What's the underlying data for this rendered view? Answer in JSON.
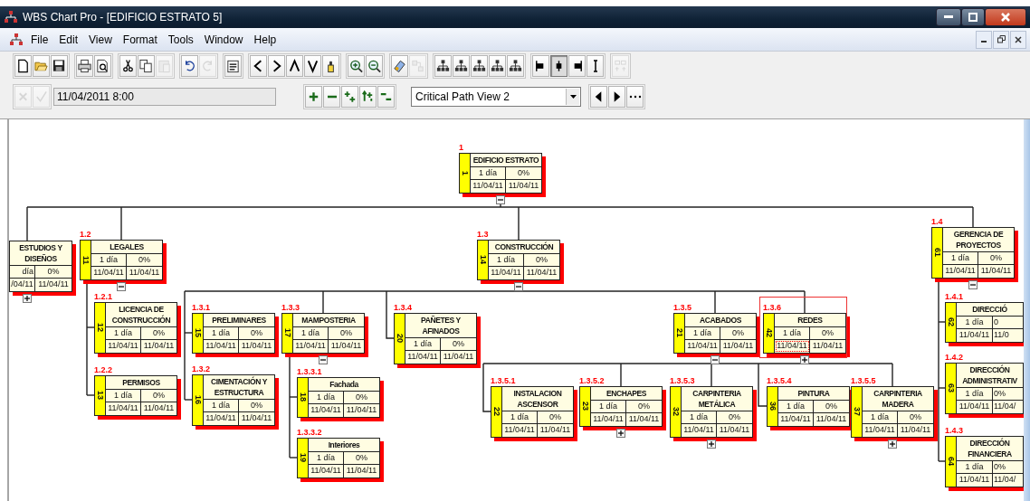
{
  "window": {
    "title": "WBS Chart Pro - [EDIFICIO ESTRATO 5]"
  },
  "menu": [
    "File",
    "Edit",
    "View",
    "Format",
    "Tools",
    "Window",
    "Help"
  ],
  "toolbar": [
    [
      {
        "kind": "new",
        "disabled": false,
        "pressed": false
      },
      {
        "kind": "open",
        "disabled": false,
        "pressed": false
      },
      {
        "kind": "save",
        "disabled": false,
        "pressed": false
      }
    ],
    [
      {
        "kind": "print",
        "disabled": false,
        "pressed": false
      },
      {
        "kind": "preview",
        "disabled": false,
        "pressed": false
      }
    ],
    [
      {
        "kind": "cut",
        "disabled": false,
        "pressed": false
      },
      {
        "kind": "copy",
        "disabled": false,
        "pressed": false
      },
      {
        "kind": "paste",
        "disabled": true,
        "pressed": false
      }
    ],
    [
      {
        "kind": "undo",
        "disabled": false,
        "pressed": false
      },
      {
        "kind": "redo",
        "disabled": true,
        "pressed": false
      }
    ],
    [
      {
        "kind": "notes",
        "disabled": false,
        "pressed": false
      }
    ],
    [
      {
        "kind": "left",
        "disabled": false,
        "pressed": false
      },
      {
        "kind": "right",
        "disabled": false,
        "pressed": false
      },
      {
        "kind": "up",
        "disabled": false,
        "pressed": false
      },
      {
        "kind": "down",
        "disabled": false,
        "pressed": false
      },
      {
        "kind": "marker",
        "disabled": false,
        "pressed": false
      }
    ],
    [
      {
        "kind": "zoom-in",
        "disabled": false,
        "pressed": false
      },
      {
        "kind": "zoom-out",
        "disabled": false,
        "pressed": false
      }
    ],
    [
      {
        "kind": "paint",
        "disabled": false,
        "pressed": false
      },
      {
        "kind": "link",
        "disabled": true,
        "pressed": false
      }
    ],
    [
      {
        "kind": "tree",
        "disabled": false,
        "pressed": false
      },
      {
        "kind": "tree-wide",
        "disabled": false,
        "pressed": false
      },
      {
        "kind": "tree-list",
        "disabled": false,
        "pressed": false
      },
      {
        "kind": "tree-both",
        "disabled": false,
        "pressed": false
      },
      {
        "kind": "tree-grid",
        "disabled": false,
        "pressed": false
      }
    ],
    [
      {
        "kind": "align-left",
        "disabled": false,
        "pressed": false
      },
      {
        "kind": "align-center",
        "disabled": false,
        "pressed": true
      },
      {
        "kind": "align-right",
        "disabled": false,
        "pressed": false
      },
      {
        "kind": "align-vertical",
        "disabled": false,
        "pressed": false
      }
    ],
    [
      {
        "kind": "grid",
        "disabled": true,
        "pressed": false
      }
    ]
  ],
  "edit_bar": {
    "buttons": [
      {
        "kind": "cancel",
        "disabled": true
      },
      {
        "kind": "confirm",
        "disabled": true
      }
    ],
    "date_field": "11/04/2011 8:00",
    "tools": [
      {
        "kind": "expand",
        "disabled": false
      },
      {
        "kind": "collapse",
        "disabled": false
      },
      {
        "kind": "expand-all",
        "disabled": false
      },
      {
        "kind": "move",
        "disabled": false
      },
      {
        "kind": "collapse-all",
        "disabled": false
      }
    ],
    "view_select": "Critical Path View 2",
    "nav": [
      {
        "kind": "prev",
        "disabled": false
      },
      {
        "kind": "next",
        "disabled": false
      },
      {
        "kind": "more",
        "disabled": false
      }
    ]
  },
  "chart": {
    "root": {
      "wbs": "1",
      "id": "1",
      "title": "EDIFICIO ESTRATO",
      "duration": "1 día",
      "percent": "0%",
      "start": "11/04/11",
      "finish": "11/04/11",
      "expanded": true,
      "selected": false,
      "children": [
        {
          "title": "ESTUDIOS Y DISEÑOS",
          "duration": "día",
          "percent": "0%",
          "start": "/04/11",
          "finish": "11/04/11",
          "expanded": false,
          "selected": false
        },
        {
          "wbs": "1.2",
          "id": "11",
          "title": "LEGALES",
          "duration": "1 día",
          "percent": "0%",
          "start": "11/04/11",
          "finish": "11/04/11",
          "expanded": true,
          "selected": false,
          "children": [
            {
              "wbs": "1.2.1",
              "id": "12",
              "title": "LICENCIA DE CONSTRUCCIÓN",
              "duration": "1 día",
              "percent": "0%",
              "start": "11/04/11",
              "finish": "11/04/11",
              "selected": false
            },
            {
              "wbs": "1.2.2",
              "id": "13",
              "title": "PERMISOS",
              "duration": "1 día",
              "percent": "0%",
              "start": "11/04/11",
              "finish": "11/04/11",
              "selected": false
            }
          ]
        },
        {
          "wbs": "1.3",
          "id": "14",
          "title": "CONSTRUCCIÓN",
          "duration": "1 día",
          "percent": "0%",
          "start": "11/04/11",
          "finish": "11/04/11",
          "expanded": true,
          "selected": false,
          "children": [
            {
              "wbs": "1.3.1",
              "id": "15",
              "title": "PRELIMINARES",
              "duration": "1 día",
              "percent": "0%",
              "start": "11/04/11",
              "finish": "11/04/11",
              "selected": false
            },
            {
              "wbs": "1.3.2",
              "id": "16",
              "title": "CIMENTACIÓN Y ESTRUCTURA",
              "duration": "1 día",
              "percent": "0%",
              "start": "11/04/11",
              "finish": "11/04/11",
              "selected": false
            },
            {
              "wbs": "1.3.3",
              "id": "17",
              "title": "MAMPOSTERIA",
              "duration": "1 día",
              "percent": "0%",
              "start": "11/04/11",
              "finish": "11/04/11",
              "expanded": true,
              "selected": false,
              "children": [
                {
                  "wbs": "1.3.3.1",
                  "id": "18",
                  "title": "Fachada",
                  "duration": "1 día",
                  "percent": "0%",
                  "start": "11/04/11",
                  "finish": "11/04/11",
                  "selected": false
                },
                {
                  "wbs": "1.3.3.2",
                  "id": "19",
                  "title": "Interiores",
                  "duration": "1 día",
                  "percent": "0%",
                  "start": "11/04/11",
                  "finish": "11/04/11",
                  "selected": false
                }
              ]
            },
            {
              "wbs": "1.3.4",
              "id": "20",
              "title": "PAÑETES Y AFINADOS",
              "duration": "1 día",
              "percent": "0%",
              "start": "11/04/11",
              "finish": "11/04/11",
              "selected": false
            },
            {
              "wbs": "1.3.5",
              "id": "21",
              "title": "ACABADOS",
              "duration": "1 día",
              "percent": "0%",
              "start": "11/04/11",
              "finish": "11/04/11",
              "expanded": true,
              "selected": false,
              "children": [
                {
                  "wbs": "1.3.5.1",
                  "id": "22",
                  "title": "INSTALACION ASCENSOR",
                  "duration": "1 día",
                  "percent": "0%",
                  "start": "11/04/11",
                  "finish": "11/04/11",
                  "selected": false
                },
                {
                  "wbs": "1.3.5.2",
                  "id": "23",
                  "title": "ENCHAPES",
                  "duration": "1 día",
                  "percent": "0%",
                  "start": "11/04/11",
                  "finish": "11/04/11",
                  "expanded": false,
                  "selected": false
                },
                {
                  "wbs": "1.3.5.3",
                  "id": "32",
                  "title": "CARPINTERIA METÁLICA",
                  "duration": "1 día",
                  "percent": "0%",
                  "start": "11/04/11",
                  "finish": "11/04/11",
                  "expanded": false,
                  "selected": false
                },
                {
                  "wbs": "1.3.5.4",
                  "id": "36",
                  "title": "PINTURA",
                  "duration": "1 día",
                  "percent": "0%",
                  "start": "11/04/11",
                  "finish": "11/04/11",
                  "selected": false
                },
                {
                  "wbs": "1.3.5.5",
                  "id": "37",
                  "title": "CARPINTERIA MADERA",
                  "duration": "1 día",
                  "percent": "0%",
                  "start": "11/04/11",
                  "finish": "11/04/11",
                  "expanded": false,
                  "selected": false
                }
              ]
            },
            {
              "wbs": "1.3.6",
              "id": "42",
              "title": "REDES",
              "duration": "1 día",
              "percent": "0%",
              "start": "11/04/11",
              "finish": "11/04/11",
              "expanded": false,
              "selected": true
            }
          ]
        },
        {
          "wbs": "1.4",
          "id": "61",
          "title": "GERENCIA DE PROYECTOS",
          "duration": "1 día",
          "percent": "0%",
          "start": "11/04/11",
          "finish": "11/04/11",
          "expanded": true,
          "selected": false,
          "children": [
            {
              "wbs": "1.4.1",
              "id": "62",
              "title": "DIRECCIÓ",
              "duration": "1 día",
              "percent": "0",
              "start": "11/04/11",
              "finish": "11/0",
              "selected": false
            },
            {
              "wbs": "1.4.2",
              "id": "63",
              "title": "DIRECCIÓN ADMINISTRATIV",
              "duration": "1 día",
              "percent": "0%",
              "start": "11/04/11",
              "finish": "11/04/",
              "selected": false
            },
            {
              "wbs": "1.4.3",
              "id": "64",
              "title": "DIRECCIÓN FINANCIERA",
              "duration": "1 día",
              "percent": "0%",
              "start": "11/04/11",
              "finish": "11/04/",
              "selected": false
            }
          ]
        }
      ]
    }
  }
}
